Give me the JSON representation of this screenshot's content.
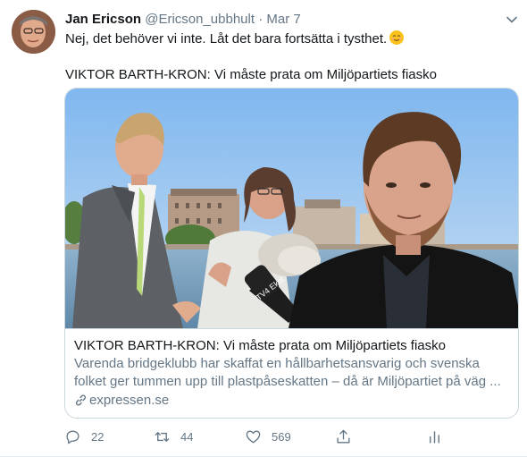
{
  "tweet": {
    "author_name": "Jan Ericson",
    "author_handle": "@Ericson_ubbhult",
    "separator": "·",
    "date": "Mar 7",
    "text_line1": "Nej, det behöver vi inte. Låt det bara fortsätta i tysthet.",
    "text_line2": "VIKTOR BARTH-KRON: Vi måste prata om Miljöpartiets fiasko"
  },
  "card": {
    "title": "VIKTOR BARTH-KRON: Vi måste prata om Miljöpartiets fiasko",
    "desc_line1": "Varenda bridgeklubb har skaffat en hållbarhetsansvarig och svenska",
    "desc_line2": "folket ger tummen upp till plastpåseskatten – då är Miljöpartiet på väg ...",
    "domain": "expressen.se",
    "mic_label": "TV4 Ekot"
  },
  "actions": {
    "reply_count": "22",
    "retweet_count": "44",
    "like_count": "569"
  },
  "icons": [
    "chevron-down-icon",
    "reply-icon",
    "retweet-icon",
    "like-icon",
    "share-icon",
    "analytics-icon",
    "link-icon",
    "smile-emoji-icon"
  ],
  "colors": {
    "secondary_text": "#657786",
    "border": "#ccd6dd",
    "primary_text": "#14171a"
  }
}
